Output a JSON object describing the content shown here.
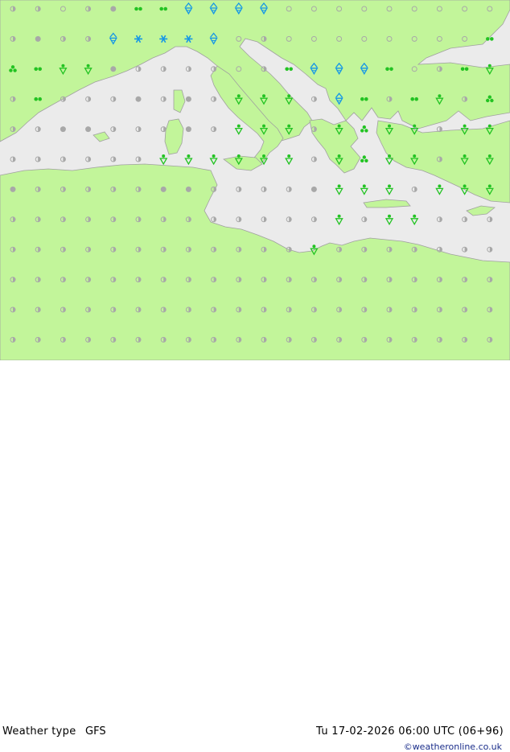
{
  "header": {
    "title": "Weather type",
    "model": "GFS",
    "datetime": "Tu 17-02-2026 06:00 UTC (06+96)"
  },
  "credit": "©weatheronline.co.uk",
  "colors": {
    "sea": "#ebebeb",
    "land": "#c2f59a",
    "border": "#a0a0a0",
    "dry_cloud": "#a8a8a8",
    "rain": "#22c322",
    "snow": "#1496e6"
  },
  "legend_icons": {
    "open": "clear-sky-icon",
    "half": "partly-cloudy-icon",
    "full": "overcast-icon",
    "drops2": "light-rain-icon",
    "drops3": "rain-icon",
    "shower": "rain-shower-icon",
    "snowshower": "snow-shower-icon",
    "snow": "snow-icon"
  },
  "grid": {
    "rows": [
      "h h . h f d1 d1 a a a a . . . . . . . . . .",
      "h f h h s1 b b b s1 . h . . . . . . . . d1 d1",
      "d2 d1 r r f h h h h . h d1 a a a d1 . h d1 r d2",
      "h d1 h h h f h f h r r r h a d1 h d1 r h d2 .",
      "h h f f h h h f h r r r h r d2 r r h r r r",
      "h h h h h h r r r r r r h r d2 r r h r r d2",
      "f h h h h h f f h h h h f r r r h r r r h",
      "h h h h h h h h h h h h h r h r r h h h h",
      "h h h h h h h h h h h h r h h h h h h h h",
      "h h h h h h h h h h h h h h h h h h h h h",
      "h h h h h h h h h h h h h h h h h h h h h",
      "h h h h h h h h h h h h h h h h h h h h h"
    ]
  }
}
